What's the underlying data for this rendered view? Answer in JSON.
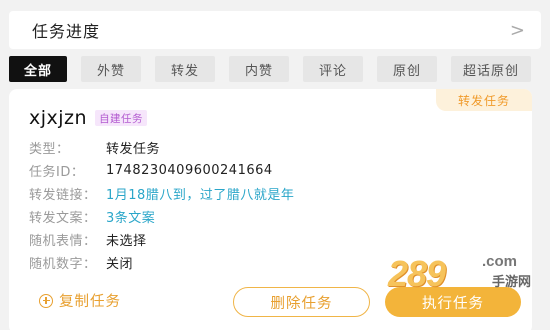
{
  "header": {
    "title": "任务进度",
    "chevron": ">"
  },
  "tabs": [
    {
      "label": "全部",
      "active": true
    },
    {
      "label": "外赞",
      "active": false
    },
    {
      "label": "转发",
      "active": false
    },
    {
      "label": "内赞",
      "active": false
    },
    {
      "label": "评论",
      "active": false
    },
    {
      "label": "原创",
      "active": false
    },
    {
      "label": "超话原创",
      "active": false
    }
  ],
  "card": {
    "corner_tag": "转发任务",
    "username": "xjxjzn",
    "badge": "自建任务",
    "rows": [
      {
        "label": "类型：",
        "value": "转发任务"
      },
      {
        "label": "任务ID：",
        "value": "1748230409600241664"
      },
      {
        "label": "转发链接：",
        "value": "1月18腊八到，过了腊八就是年"
      },
      {
        "label": "转发文案：",
        "value": "3条文案"
      },
      {
        "label": "随机表情：",
        "value": "未选择"
      },
      {
        "label": "随机数字：",
        "value": "关闭"
      }
    ],
    "buttons": {
      "copy": "复制任务",
      "delete": "删除任务",
      "execute": "执行任务"
    }
  },
  "watermark": {
    "number": "289",
    "domain": ".com",
    "sub": "手游网"
  },
  "colors": {
    "accent": "#f3b43a",
    "link": "#2aa6c9",
    "badge": "#b35bd0",
    "tab_active_bg": "#111111"
  }
}
